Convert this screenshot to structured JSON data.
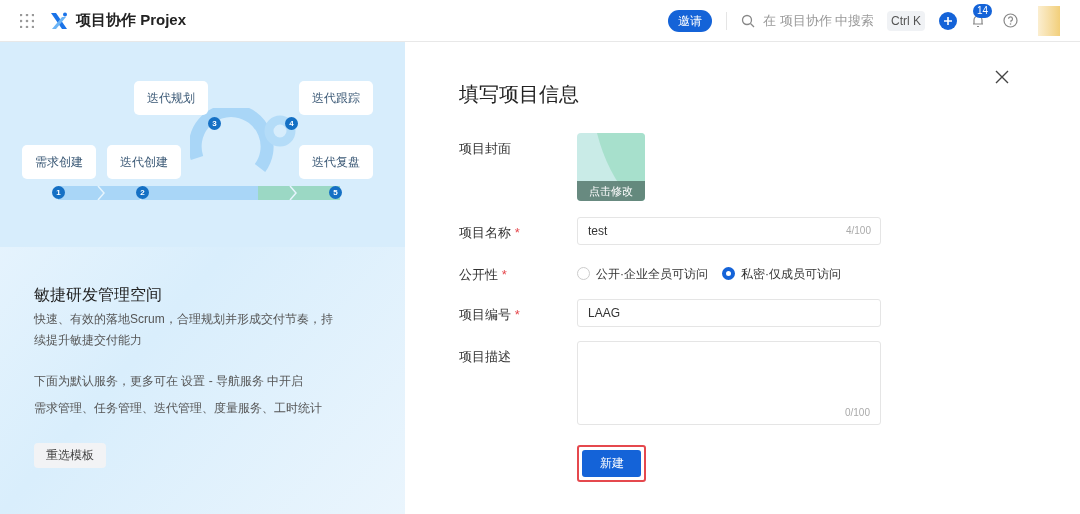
{
  "header": {
    "app_title": "项目协作 Projex",
    "invite_button": "邀请",
    "search": {
      "placeholder": "在 项目协作 中搜索"
    },
    "shortcut": "Ctrl K",
    "notification_count": "14"
  },
  "template": {
    "steps": [
      {
        "number": "1",
        "label": "需求创建"
      },
      {
        "number": "2",
        "label": "迭代创建"
      },
      {
        "number": "3",
        "label": "迭代规划"
      },
      {
        "number": "4",
        "label": "迭代跟踪"
      },
      {
        "number": "5",
        "label": "迭代复盘"
      }
    ],
    "title": "敏捷研发管理空间",
    "description": "快速、有效的落地Scrum，合理规划并形成交付节奏，持续提升敏捷交付能力",
    "services_note": "下面为默认服务，更多可在 设置 - 导航服务 中开启",
    "services": "需求管理、任务管理、迭代管理、度量服务、工时统计",
    "reselect_button": "重选模板"
  },
  "form": {
    "title": "填写项目信息",
    "cover": {
      "label": "项目封面",
      "overlay": "点击修改"
    },
    "name": {
      "label": "项目名称",
      "required_mark": "*",
      "value": "test",
      "counter": "4/100"
    },
    "visibility": {
      "label": "公开性",
      "required_mark": "*",
      "options": [
        {
          "label": "公开·企业全员可访问",
          "selected": false
        },
        {
          "label": "私密·仅成员可访问",
          "selected": true
        }
      ]
    },
    "code": {
      "label": "项目编号",
      "required_mark": "*",
      "value": "LAAG"
    },
    "description": {
      "label": "项目描述",
      "counter": "0/100"
    },
    "submit_button": "新建",
    "submit_highlighted": true
  }
}
